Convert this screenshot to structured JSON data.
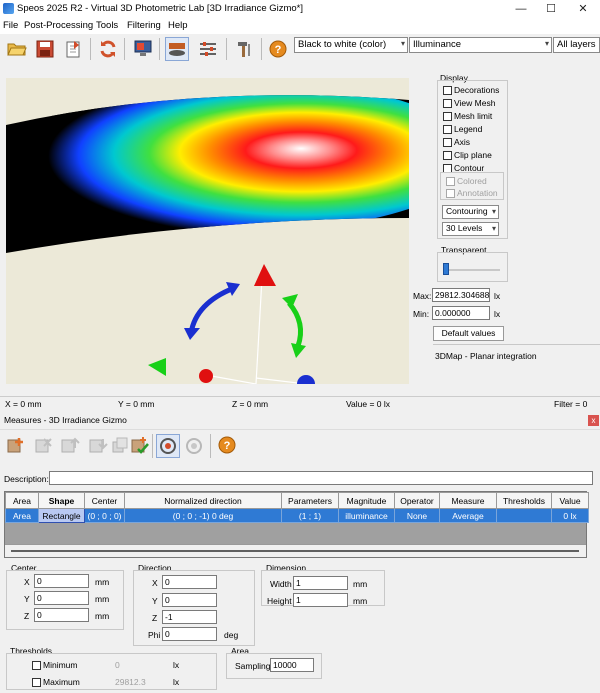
{
  "window": {
    "title": "Speos 2025 R2 - Virtual 3D Photometric Lab [3D Irradiance Gizmo*]",
    "controls": {
      "minimize": "—",
      "maximize": "☐",
      "close": "✕"
    }
  },
  "menu": [
    "File",
    "Post-Processing",
    "Tools",
    "Filtering",
    "Help"
  ],
  "toolbar": {
    "colormap": "Black to white (color)",
    "quantity": "Illuminance",
    "layers": "All layers"
  },
  "display_panel": {
    "title": "Display",
    "checkboxes": [
      {
        "label": "Decorations",
        "checked": false,
        "disabled": false
      },
      {
        "label": "View Mesh",
        "checked": false,
        "disabled": false
      },
      {
        "label": "Mesh limit",
        "checked": false,
        "disabled": false
      },
      {
        "label": "Legend",
        "checked": false,
        "disabled": false
      },
      {
        "label": "Axis",
        "checked": false,
        "disabled": false
      },
      {
        "label": "Clip plane",
        "checked": false,
        "disabled": false
      },
      {
        "label": "Contour",
        "checked": false,
        "disabled": false
      }
    ],
    "contour_sub": [
      {
        "label": "Colored",
        "checked": false,
        "disabled": true
      },
      {
        "label": "Annotation",
        "checked": false,
        "disabled": true
      }
    ],
    "render_mode": "Contouring",
    "levels": "30 Levels",
    "transparent_label": "Transparent",
    "transparency": 0.0,
    "max_label": "Max:",
    "max_value": "29812.304688",
    "min_label": "Min:",
    "min_value": "0.000000",
    "unit": "lx",
    "default_button": "Default values",
    "map_info": "3DMap - Planar integration"
  },
  "status": {
    "x": "X = 0 mm",
    "y": "Y = 0 mm",
    "z": "Z = 0 mm",
    "value": "Value = 0 lx",
    "filter": "Filter = 0"
  },
  "measures": {
    "title": "Measures - 3D Irradiance Gizmo",
    "close": "x",
    "description_label": "Description:",
    "description_value": "",
    "columns": [
      "Area",
      "Shape",
      "Center",
      "Normalized direction",
      "Parameters",
      "Magnitude",
      "Operator",
      "Measure",
      "Thresholds",
      "Value"
    ],
    "rows": [
      [
        "Area",
        "Rectangle",
        "(0 ; 0 ; 0)",
        "(0 ; 0 ; -1) 0 deg",
        "(1 ; 1)",
        "illuminance",
        "None",
        "Average",
        "",
        "0 lx"
      ]
    ]
  },
  "center_group": {
    "title": "Center",
    "x_label": "X",
    "x": "0",
    "y_label": "Y",
    "y": "0",
    "z_label": "Z",
    "z": "0",
    "unit": "mm"
  },
  "direction_group": {
    "title": "Direction",
    "x_label": "X",
    "x": "0",
    "y_label": "Y",
    "y": "0",
    "z_label": "Z",
    "z": "-1",
    "phi_label": "Phi",
    "phi": "0",
    "phi_unit": "deg"
  },
  "dimension_group": {
    "title": "Dimension",
    "width_label": "Width",
    "width": "1",
    "height_label": "Height",
    "height": "1",
    "unit": "mm"
  },
  "thresholds_group": {
    "title": "Thresholds",
    "minimum_label": "Minimum",
    "minimum": "0",
    "maximum_label": "Maximum",
    "maximum": "29812.3",
    "unit": "lx"
  },
  "area_group": {
    "title": "Area",
    "sampling_label": "Sampling",
    "sampling": "10000"
  }
}
